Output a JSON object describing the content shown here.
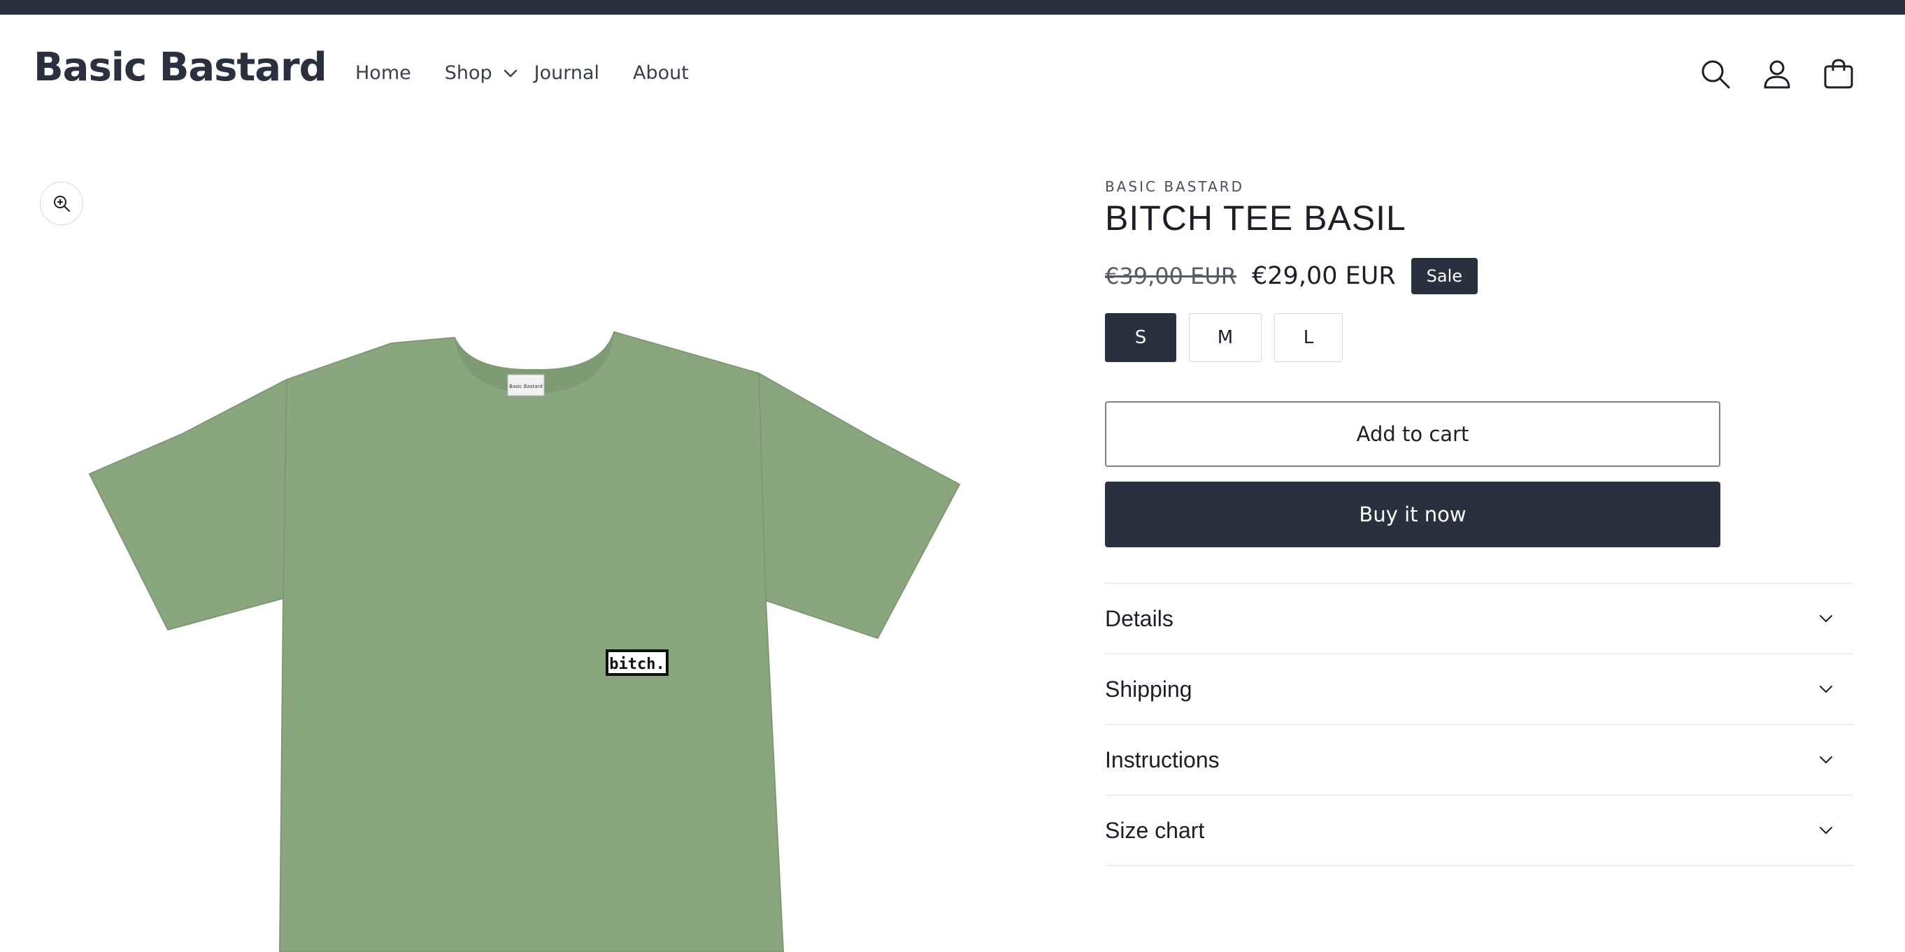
{
  "header": {
    "logo": "Basic Bastard",
    "nav": [
      {
        "label": "Home"
      },
      {
        "label": "Shop"
      },
      {
        "label": "Journal"
      },
      {
        "label": "About"
      }
    ],
    "icons": [
      "search-icon",
      "account-icon",
      "cart-icon"
    ]
  },
  "product": {
    "vendor": "BASIC BASTARD",
    "title": "BITCH TEE BASIL",
    "price_original": "€39,00 EUR",
    "price_sale": "€29,00 EUR",
    "sale_badge": "Sale",
    "sizes": [
      {
        "label": "S",
        "selected": true
      },
      {
        "label": "M",
        "selected": false
      },
      {
        "label": "L",
        "selected": false
      }
    ],
    "add_to_cart": "Add to cart",
    "buy_now": "Buy it now",
    "image_patch_text": "bitch.",
    "image_neck_label": "Basic Bastard",
    "accordion": [
      {
        "label": "Details"
      },
      {
        "label": "Shipping"
      },
      {
        "label": "Instructions"
      },
      {
        "label": "Size chart"
      }
    ]
  },
  "colors": {
    "primary": "#2a303e",
    "shirt": "#8aa67f",
    "background": "#ffffff"
  }
}
